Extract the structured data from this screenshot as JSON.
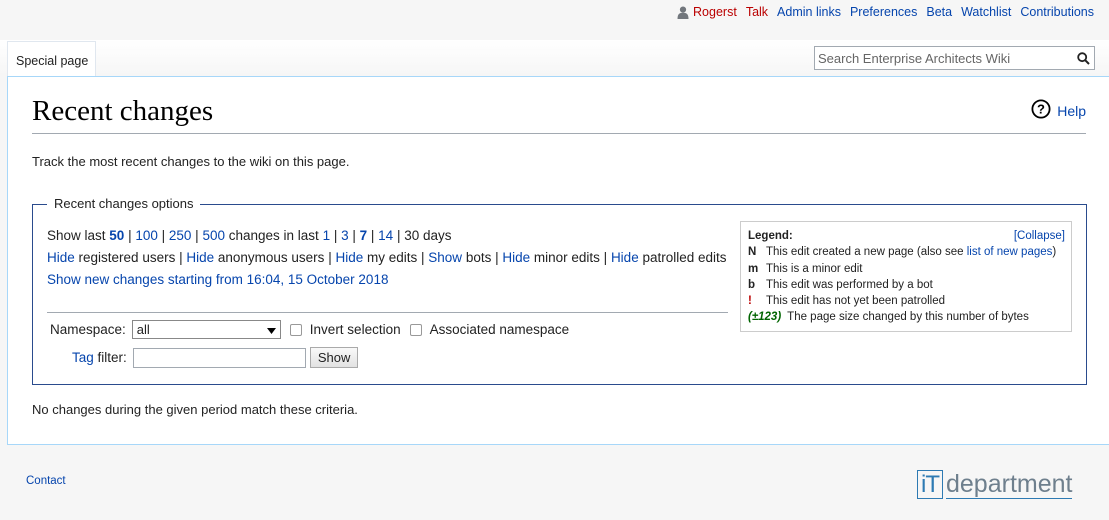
{
  "personal": {
    "user": "Rogerst",
    "items": [
      "Talk",
      "Admin links",
      "Preferences",
      "Beta",
      "Watchlist",
      "Contributions"
    ],
    "user_icon": "user-icon"
  },
  "tabs": {
    "special_page": "Special page"
  },
  "search": {
    "placeholder": "Search Enterprise Architects Wiki",
    "icon": "search-icon"
  },
  "page": {
    "title": "Recent changes",
    "help": "Help",
    "intro": "Track the most recent changes to the wiki on this page.",
    "no_changes": "No changes during the given period match these criteria."
  },
  "options": {
    "legend": "Recent changes options",
    "show_last": "Show last",
    "limits": [
      "50",
      "100",
      "250",
      "500"
    ],
    "changes_in_last": "changes in last",
    "days": [
      "1",
      "3",
      "7",
      "14",
      "30 days"
    ],
    "hide": "Hide",
    "show": "Show",
    "registered_users": "registered users",
    "anonymous_users": "anonymous users",
    "my_edits": "my edits",
    "bots": "bots",
    "minor_edits": "minor edits",
    "patrolled_edits": "patrolled edits",
    "new_changes_link": "Show new changes starting from 16:04, 15 October 2018",
    "namespace_label": "Namespace:",
    "namespace_value": "all",
    "invert_selection": "Invert selection",
    "associated_namespace": "Associated namespace",
    "tag_label_link": "Tag",
    "tag_label_rest": "filter:",
    "show_button": "Show"
  },
  "legend": {
    "title": "Legend:",
    "collapse": "[Collapse]",
    "rows": [
      {
        "sym": "N",
        "text": "This edit created a new page (also see ",
        "link": "list of new pages",
        "after": ")"
      },
      {
        "sym": "m",
        "text": "This is a minor edit"
      },
      {
        "sym": "b",
        "text": "This edit was performed by a bot"
      },
      {
        "sym": "!",
        "text": "This edit has not yet been patrolled"
      },
      {
        "sym": "(±123)",
        "text": "The page size changed by this number of bytes"
      }
    ]
  },
  "footer": {
    "contact": "Contact",
    "logo_it": "iT",
    "logo_dept": "department"
  },
  "colors": {
    "link": "#0645ad",
    "red_link": "#ba0000",
    "border_blue": "#2a4b8d",
    "size_green": "#006400"
  }
}
